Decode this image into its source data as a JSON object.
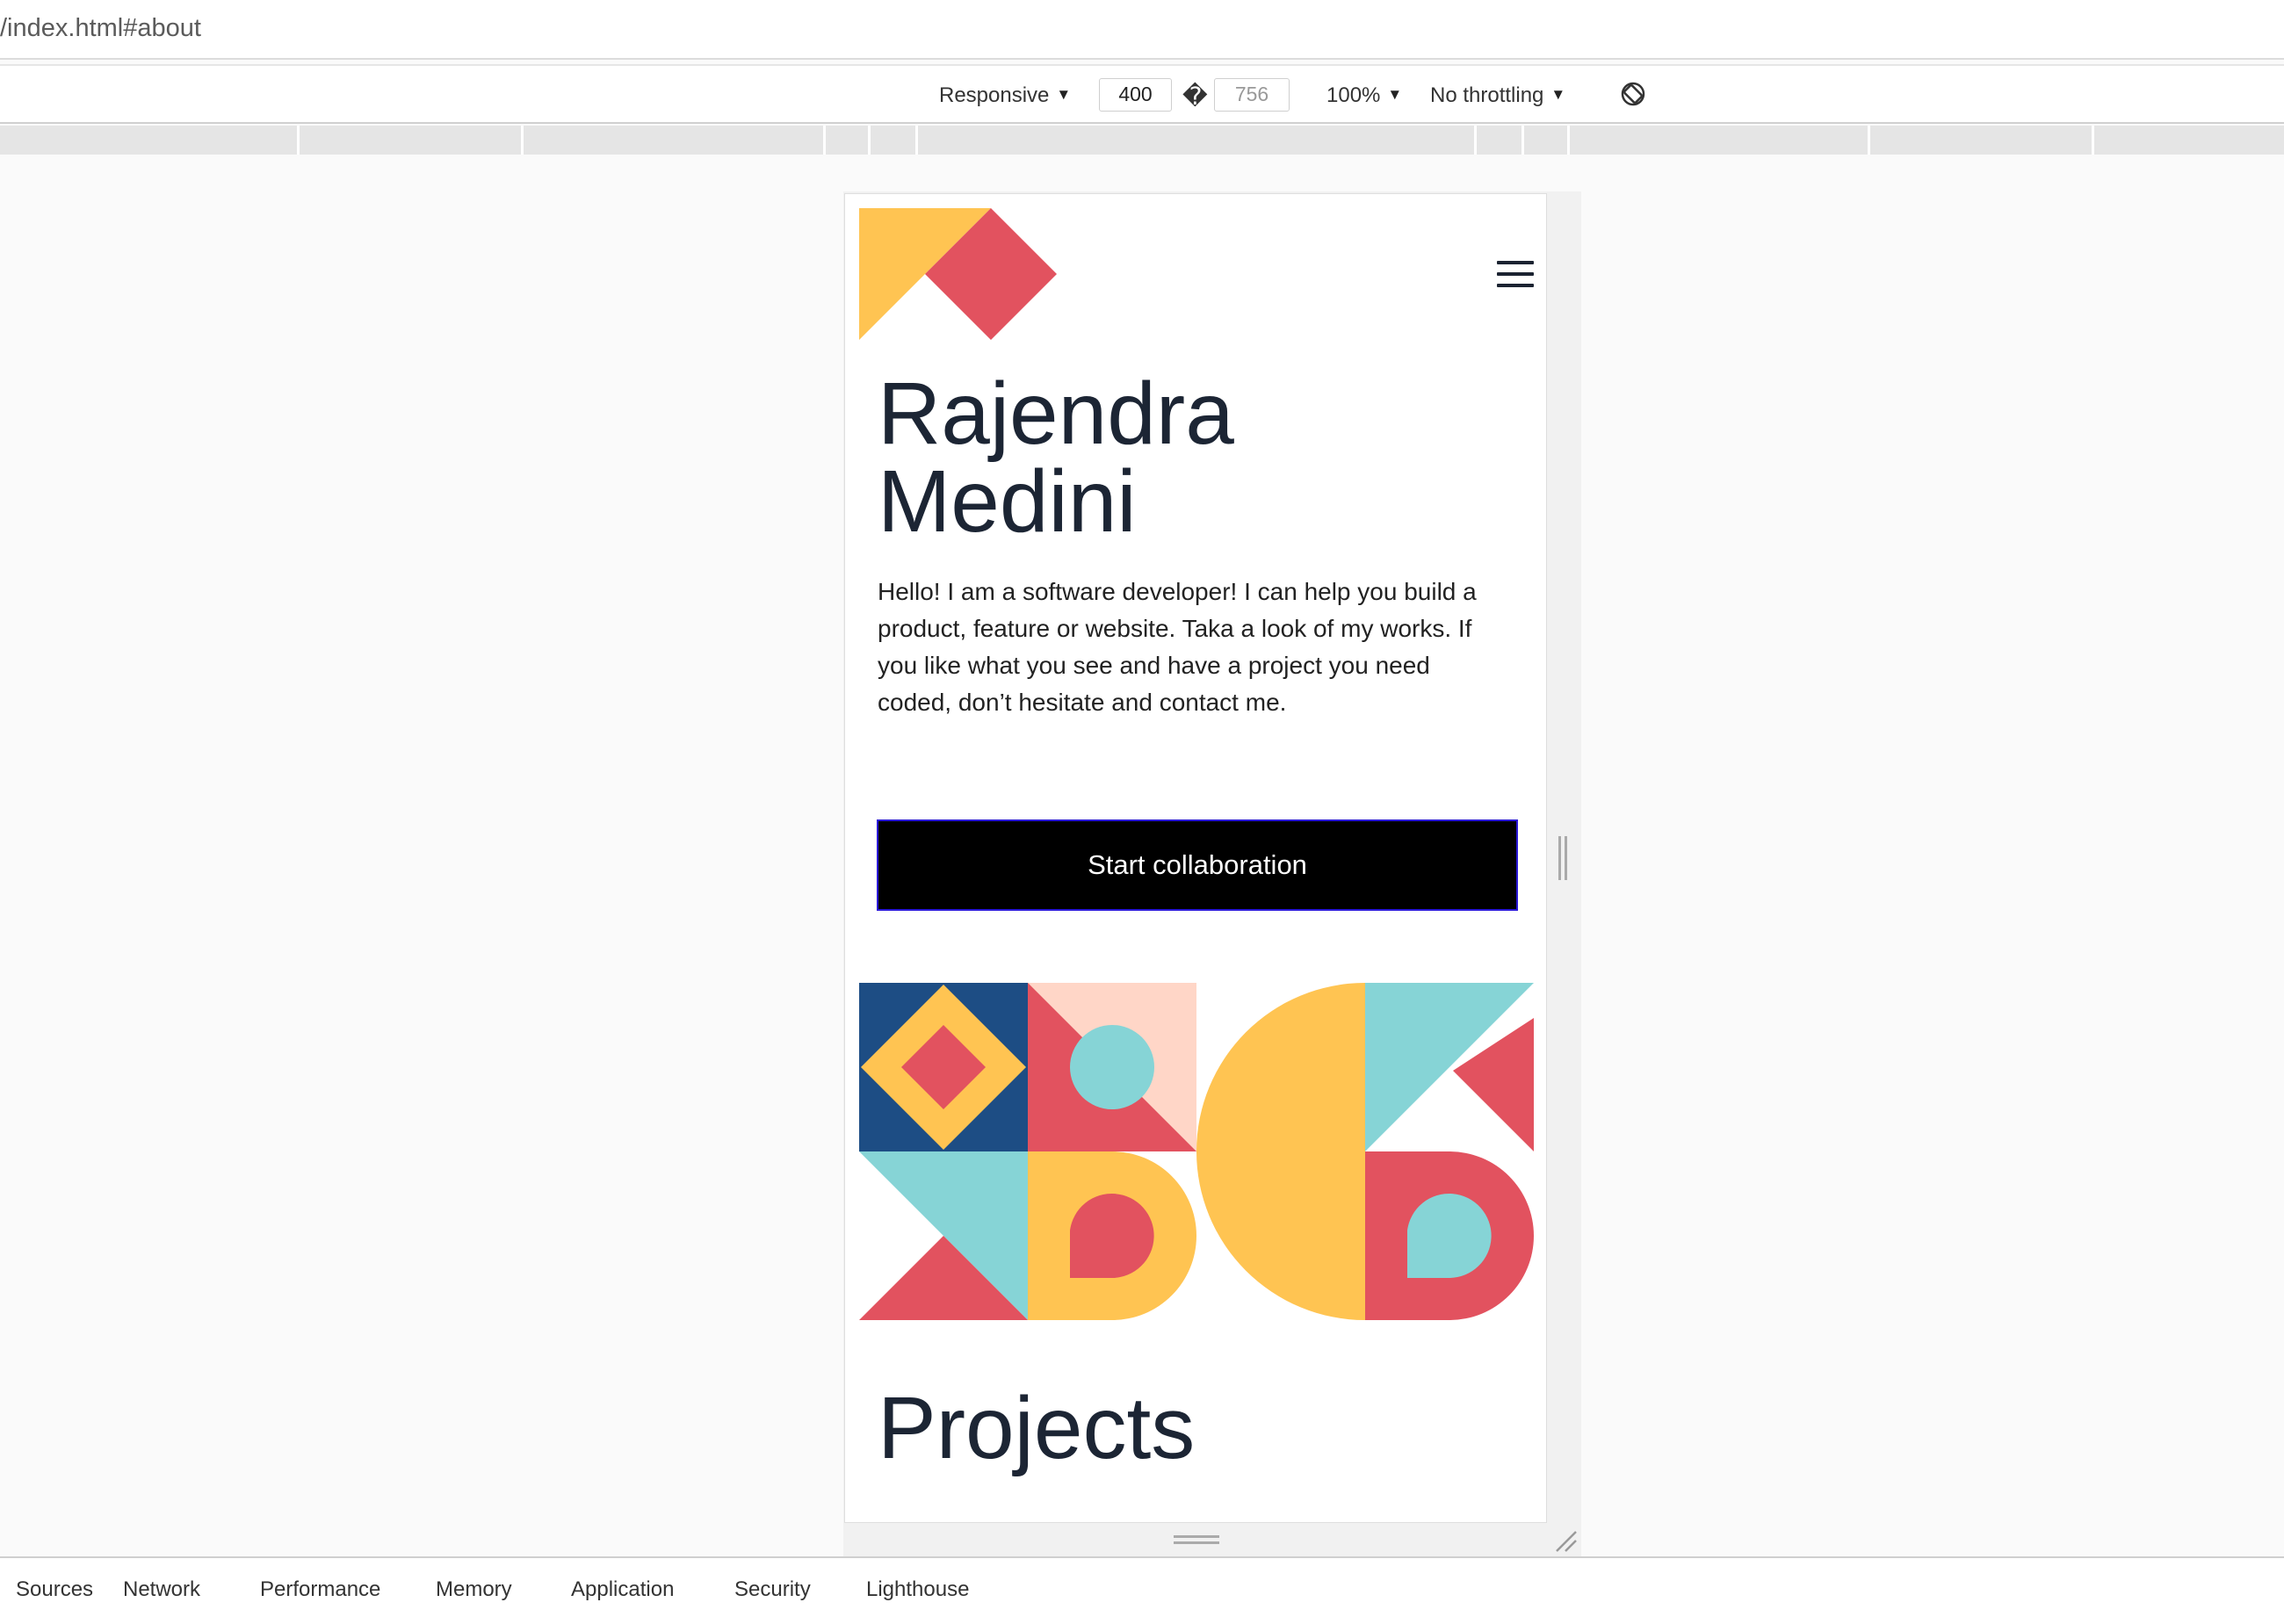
{
  "browser": {
    "url": "/index.html#about"
  },
  "device_toolbar": {
    "mode": "Responsive",
    "width": "400",
    "dimension_separator": "�",
    "height": "756",
    "zoom": "100%",
    "throttling": "No throttling",
    "rotate_icon": "rotate-icon"
  },
  "page": {
    "name_line1": "Rajendra",
    "name_line2": "Medini",
    "intro": "Hello! I am a software developer! I can help you build a product, feature or website. Taka a look of my works. If you like what you see and have a project you need coded, don’t hesitate and contact me.",
    "cta_label": "Start collaboration",
    "section_title": "Projects",
    "menu_icon": "hamburger-menu-icon",
    "colors": {
      "yellow": "#ffc452",
      "red": "#e2525f",
      "navy": "#1d4d84",
      "teal": "#86d4d6",
      "peach": "#ffd6c7",
      "text": "#1c2534"
    }
  },
  "devtools_tabs": [
    "Sources",
    "Network",
    "Performance",
    "Memory",
    "Application",
    "Security",
    "Lighthouse"
  ]
}
